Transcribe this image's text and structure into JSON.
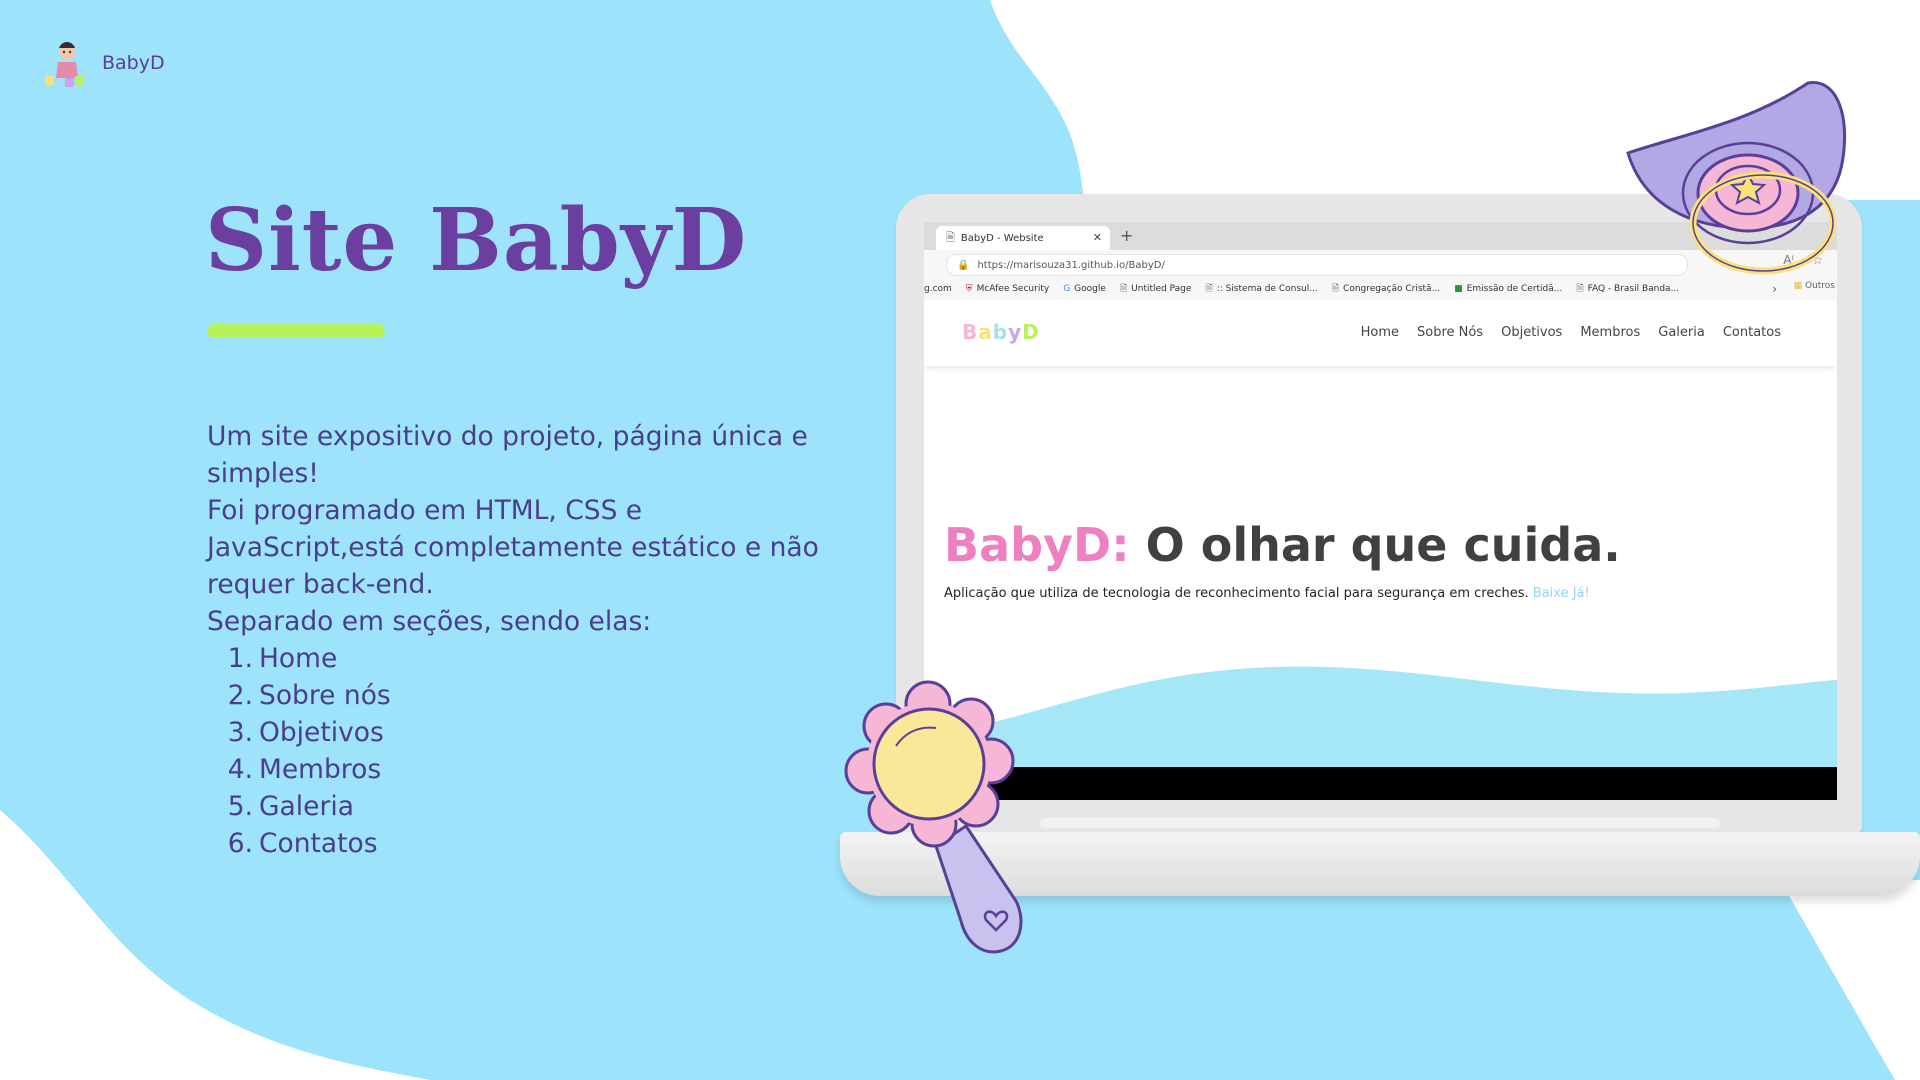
{
  "colors": {
    "sky_blue": "#9de3fb",
    "title_purple": "#6a3fa0",
    "text_purple": "#4a3e8c",
    "accent_green": "#b8f25a",
    "hero_pink": "#ee7fc0"
  },
  "brand": {
    "name": "BabyD",
    "logo_icon": "baby-icon"
  },
  "slide": {
    "title": "Site BabyD",
    "intro_line1": "Um site expositivo do projeto, página única e simples!",
    "intro_line2": "Foi programado em HTML, CSS e JavaScript,está completamente estático e não requer back-end.",
    "intro_line3": "Separado em seções, sendo elas:",
    "sections": [
      {
        "num": "1.",
        "label": "Home"
      },
      {
        "num": "2.",
        "label": "Sobre nós"
      },
      {
        "num": "3.",
        "label": "Objetivos"
      },
      {
        "num": "4.",
        "label": "Membros"
      },
      {
        "num": "5.",
        "label": "Galeria"
      },
      {
        "num": "6.",
        "label": "Contatos"
      }
    ]
  },
  "browser": {
    "tab_title": "BabyD - Website",
    "url": "https://marisouza31.github.io/BabyD/",
    "bookmarks": [
      {
        "label": "g.com",
        "icon": ""
      },
      {
        "label": "McAfee Security",
        "icon": "mcafee-icon"
      },
      {
        "label": "Google",
        "icon": "google-icon"
      },
      {
        "label": "Untitled Page",
        "icon": "page-icon"
      },
      {
        "label": ":: Sistema de Consul...",
        "icon": "page-icon"
      },
      {
        "label": "Congregação Cristã...",
        "icon": "page-icon"
      },
      {
        "label": "Emissão de Certidã...",
        "icon": "flag-icon"
      },
      {
        "label": "FAQ - Brasil Banda...",
        "icon": "page-icon"
      }
    ],
    "folder_label": "Outros"
  },
  "website": {
    "logo_text": "BabyD",
    "menu": [
      "Home",
      "Sobre Nós",
      "Objetivos",
      "Membros",
      "Galeria",
      "Contatos"
    ],
    "hero_brand": "BabyD:",
    "hero_tagline": " O olhar que cuida.",
    "hero_sub": "Aplicação que utiliza de tecnologia de reconhecimento facial para segurança em creches.",
    "hero_cta": " Baixe Já!"
  }
}
